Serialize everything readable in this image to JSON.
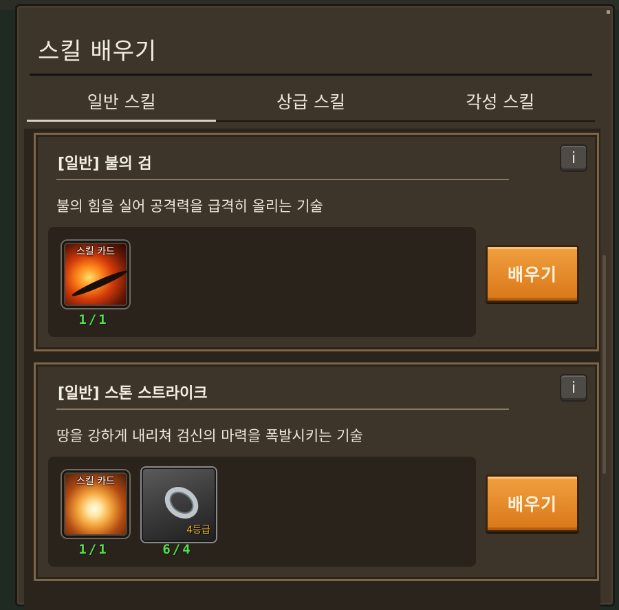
{
  "window": {
    "title": "스킬 배우기"
  },
  "tabs": [
    {
      "label": "일반 스킬",
      "active": true
    },
    {
      "label": "상급 스킬",
      "active": false
    },
    {
      "label": "각성 스킬",
      "active": false
    }
  ],
  "skills": [
    {
      "title": "[일반] 불의 검",
      "description": "불의 힘을 실어 공격력을 급격히 올리는 기술",
      "info_label": "i",
      "items": [
        {
          "label": "스킬 카드",
          "count": "1/1",
          "icon": "fire-sword-skill-card-icon"
        }
      ],
      "learn_label": "배우기"
    },
    {
      "title": "[일반] 스톤 스트라이크",
      "description": "땅을 강하게 내리쳐 검신의 마력을 폭발시키는 기술",
      "info_label": "i",
      "items": [
        {
          "label": "스킬 카드",
          "count": "1/1",
          "icon": "stone-strike-skill-card-icon"
        },
        {
          "label": "",
          "grade": "4등급",
          "count": "6/4",
          "icon": "silver-ring-icon"
        }
      ],
      "learn_label": "배우기"
    }
  ],
  "colors": {
    "learn_button": "#e08a26",
    "count_green": "#52e14a",
    "grade_gold": "#f2b21f",
    "card_border": "#7d6648"
  }
}
